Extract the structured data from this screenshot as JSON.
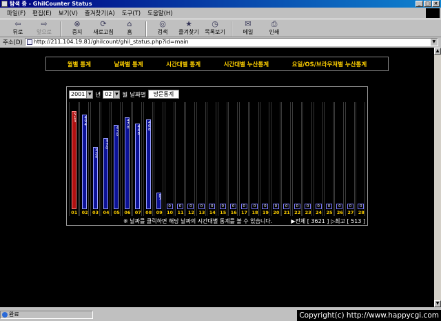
{
  "window": {
    "title": "탐색 중 - GhilCounter Status",
    "minimize": "_",
    "maximize": "□",
    "close": "×"
  },
  "menubar": [
    "파일(F)",
    "편집(E)",
    "보기(V)",
    "즐겨찾기(A)",
    "도구(T)",
    "도움말(H)"
  ],
  "toolbar": [
    {
      "label": "뒤로",
      "icon": "back-arrow-icon",
      "glyph": "⇦",
      "enabled": true
    },
    {
      "label": "앞으로",
      "icon": "forward-arrow-icon",
      "glyph": "⇨",
      "enabled": false
    },
    {
      "label": "중지",
      "icon": "stop-icon",
      "glyph": "⊗",
      "enabled": true
    },
    {
      "label": "새로고침",
      "icon": "refresh-icon",
      "glyph": "⟳",
      "enabled": true
    },
    {
      "label": "홈",
      "icon": "home-icon",
      "glyph": "⌂",
      "enabled": true
    },
    {
      "label": "검색",
      "icon": "search-icon",
      "glyph": "◎",
      "enabled": true
    },
    {
      "label": "즐겨찾기",
      "icon": "favorites-icon",
      "glyph": "★",
      "enabled": true
    },
    {
      "label": "목록보기",
      "icon": "history-icon",
      "glyph": "◷",
      "enabled": true
    },
    {
      "label": "메일",
      "icon": "mail-icon",
      "glyph": "✉",
      "enabled": true
    },
    {
      "label": "인쇄",
      "icon": "print-icon",
      "glyph": "⎙",
      "enabled": true
    }
  ],
  "address": {
    "label": "주소(D)",
    "url": "http://211.104.19.81/ghilcount/ghil_status.php?id=main"
  },
  "nav": [
    "월별 통계",
    "날짜별 통계",
    "시간대별 통계",
    "시간대별 누산통계",
    "요일/OS/브라우져별 누산통계"
  ],
  "controls": {
    "year": "2001",
    "year_unit": "년",
    "month": "02",
    "month_unit": "월",
    "by_date": "날짜별",
    "visit_button": "방문통계"
  },
  "colors": {
    "nav_text": "#ffd000",
    "bar_blue": "#0c1296",
    "bar_red": "#b01010",
    "background": "#000000"
  },
  "chart_data": {
    "type": "bar",
    "categories": [
      "01",
      "02",
      "03",
      "04",
      "05",
      "06",
      "07",
      "08",
      "09",
      "10",
      "11",
      "12",
      "13",
      "14",
      "15",
      "16",
      "17",
      "18",
      "19",
      "20",
      "21",
      "22",
      "23",
      "24",
      "25",
      "26",
      "27",
      "28"
    ],
    "values": [
      513,
      494,
      324,
      370,
      439,
      478,
      448,
      468,
      87,
      0,
      0,
      0,
      0,
      0,
      0,
      0,
      0,
      0,
      0,
      0,
      0,
      0,
      0,
      0,
      0,
      0,
      0,
      0
    ],
    "highlight_index": 0,
    "ylim": [
      0,
      650
    ]
  },
  "footer": {
    "note": "※ 날짜를 클릭하면 해당 날짜의 시간대별 통계를 볼 수 있습니다.",
    "total_label": "▶전체 [ 3621 ]",
    "max_label": "▷최고 [ 513 ]"
  },
  "status": {
    "text": "완료",
    "copyright": "Copyright(c) http://www.happycgi.com"
  }
}
